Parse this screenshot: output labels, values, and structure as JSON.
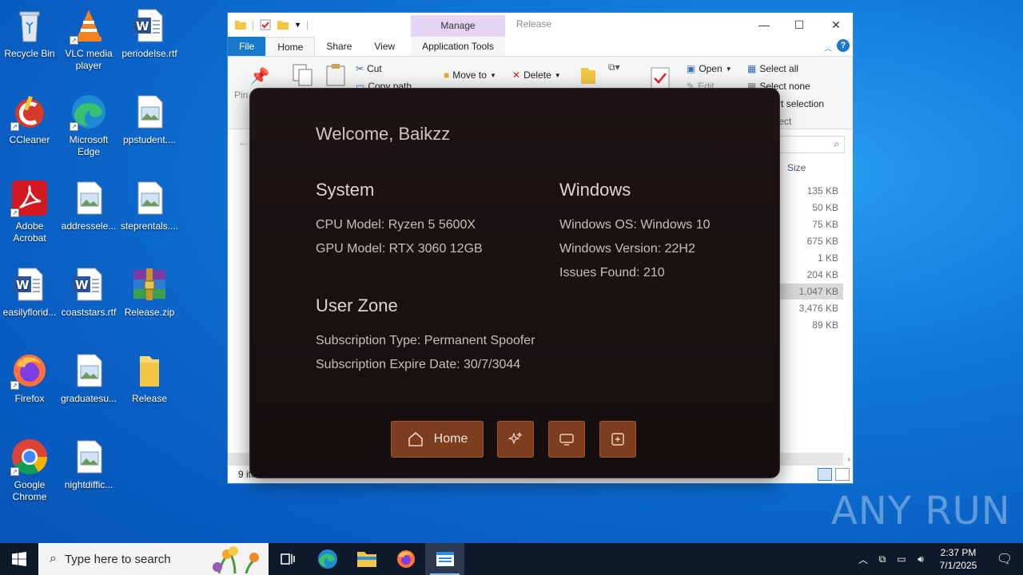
{
  "desktop": {
    "icons": [
      {
        "label": "Recycle Bin",
        "icon": "recycle-bin-icon"
      },
      {
        "label": "VLC media player",
        "icon": "vlc-icon"
      },
      {
        "label": "periodelse.rtf",
        "icon": "word-document-icon"
      },
      {
        "label": "CCleaner",
        "icon": "ccleaner-icon"
      },
      {
        "label": "Microsoft Edge",
        "icon": "edge-icon"
      },
      {
        "label": "ppstudent....",
        "icon": "image-file-icon"
      },
      {
        "label": "Adobe Acrobat",
        "icon": "acrobat-icon"
      },
      {
        "label": "addressele...",
        "icon": "image-file-icon"
      },
      {
        "label": "steprentals....",
        "icon": "image-file-icon"
      },
      {
        "label": "easilyflorid...",
        "icon": "word-document-icon"
      },
      {
        "label": "coaststars.rtf",
        "icon": "word-document-icon"
      },
      {
        "label": "Release.zip",
        "icon": "winrar-icon"
      },
      {
        "label": "Firefox",
        "icon": "firefox-icon"
      },
      {
        "label": "graduatesu...",
        "icon": "image-file-icon"
      },
      {
        "label": "Release",
        "icon": "folder-icon"
      },
      {
        "label": "Google Chrome",
        "icon": "chrome-icon"
      },
      {
        "label": "nightdiffic...",
        "icon": "image-file-icon"
      }
    ]
  },
  "explorer": {
    "title": "Release",
    "context_tab": "Manage",
    "tabs": {
      "file": "File",
      "home": "Home",
      "share": "Share",
      "view": "View",
      "app_tools": "Application Tools"
    },
    "ribbon": {
      "pin": "Pin to Quick",
      "cut": "Cut",
      "copy_path": "Copy path",
      "move_to": "Move to",
      "delete": "Delete",
      "open": "Open",
      "edit": "Edit",
      "select_all": "Select all",
      "select_none": "Select none",
      "invert_selection": "Invert selection",
      "select": "Select"
    },
    "column_size": "Size",
    "sizes": [
      "135 KB",
      "50 KB",
      "75 KB",
      "675 KB",
      "1 KB",
      "204 KB",
      "1,047 KB",
      "3,476 KB",
      "89 KB"
    ],
    "selected_index": 6,
    "status_items": "9 items"
  },
  "app": {
    "welcome": "Welcome, Baikzz",
    "system": {
      "heading": "System",
      "cpu": "CPU Model: Ryzen 5 5600X",
      "gpu": "GPU Model: RTX 3060 12GB"
    },
    "windows": {
      "heading": "Windows",
      "os": "Windows OS: Windows 10",
      "version": "Windows Version: 22H2",
      "issues": "Issues Found: 210"
    },
    "user_zone": {
      "heading": "User Zone",
      "subscription_type": "Subscription Type: Permanent Spoofer",
      "expire_date": "Subscription Expire Date: 30/7/3044"
    },
    "nav": {
      "home": "Home"
    },
    "accent": "#7c3e1e"
  },
  "taskbar": {
    "search_placeholder": "Type here to search",
    "time": "2:37 PM",
    "date": "7/1/2025"
  },
  "watermark": "ANY RUN"
}
